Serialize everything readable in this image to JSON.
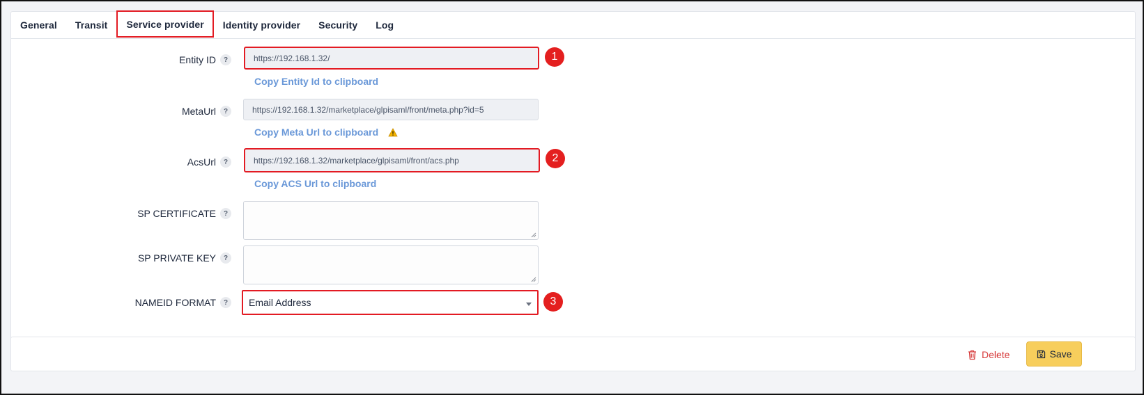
{
  "tabs": [
    {
      "label": "General"
    },
    {
      "label": "Transit"
    },
    {
      "label": "Service provider"
    },
    {
      "label": "Identity provider"
    },
    {
      "label": "Security"
    },
    {
      "label": "Log"
    }
  ],
  "active_tab": "Service provider",
  "help_glyph": "?",
  "entity_id": {
    "label": "Entity ID",
    "value": "https://192.168.1.32/",
    "copy_link": "Copy Entity Id to clipboard"
  },
  "meta_url": {
    "label": "MetaUrl",
    "value": "https://192.168.1.32/marketplace/glpisaml/front/meta.php?id=5",
    "copy_link": "Copy Meta Url to clipboard",
    "warning_icon": "warning-triangle-icon"
  },
  "acs_url": {
    "label": "AcsUrl",
    "value": "https://192.168.1.32/marketplace/glpisaml/front/acs.php",
    "copy_link": "Copy ACS Url to clipboard"
  },
  "sp_certificate": {
    "label": "SP CERTIFICATE",
    "value": ""
  },
  "sp_private_key": {
    "label": "SP PRIVATE KEY",
    "value": ""
  },
  "nameid_format": {
    "label": "NAMEID FORMAT",
    "selected": "Email Address"
  },
  "annotations": [
    "1",
    "2",
    "3"
  ],
  "footer": {
    "delete_label": "Delete",
    "save_label": "Save"
  },
  "colors": {
    "highlight": "#e31b23",
    "link": "#6a98d8",
    "delete": "#d63939",
    "save_bg": "#f7ce5c",
    "badge": "#e41f1f"
  }
}
